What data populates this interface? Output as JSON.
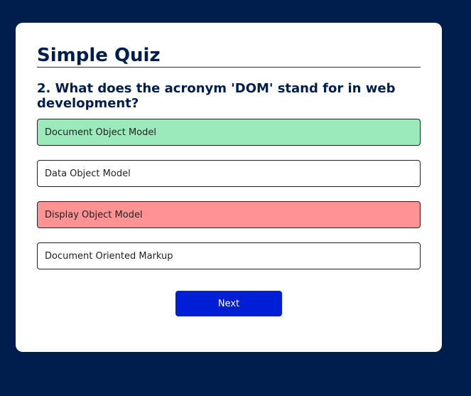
{
  "app": {
    "title": "Simple Quiz"
  },
  "question": {
    "text": "2. What does the acronym 'DOM' stand for in web development?"
  },
  "answers": [
    {
      "label": "Document Object Model",
      "state": "correct",
      "color": "#9aeabc"
    },
    {
      "label": "Data Object Model",
      "state": "neutral",
      "color": "#ffffff"
    },
    {
      "label": "Display Object Model",
      "state": "incorrect",
      "color": "#ff9393"
    },
    {
      "label": "Document Oriented Markup",
      "state": "neutral",
      "color": "#ffffff"
    }
  ],
  "controls": {
    "next_label": "Next"
  },
  "colors": {
    "background": "#001e4d",
    "card": "#ffffff",
    "accent": "#001ed5",
    "correct": "#9aeabc",
    "incorrect": "#ff9393"
  }
}
